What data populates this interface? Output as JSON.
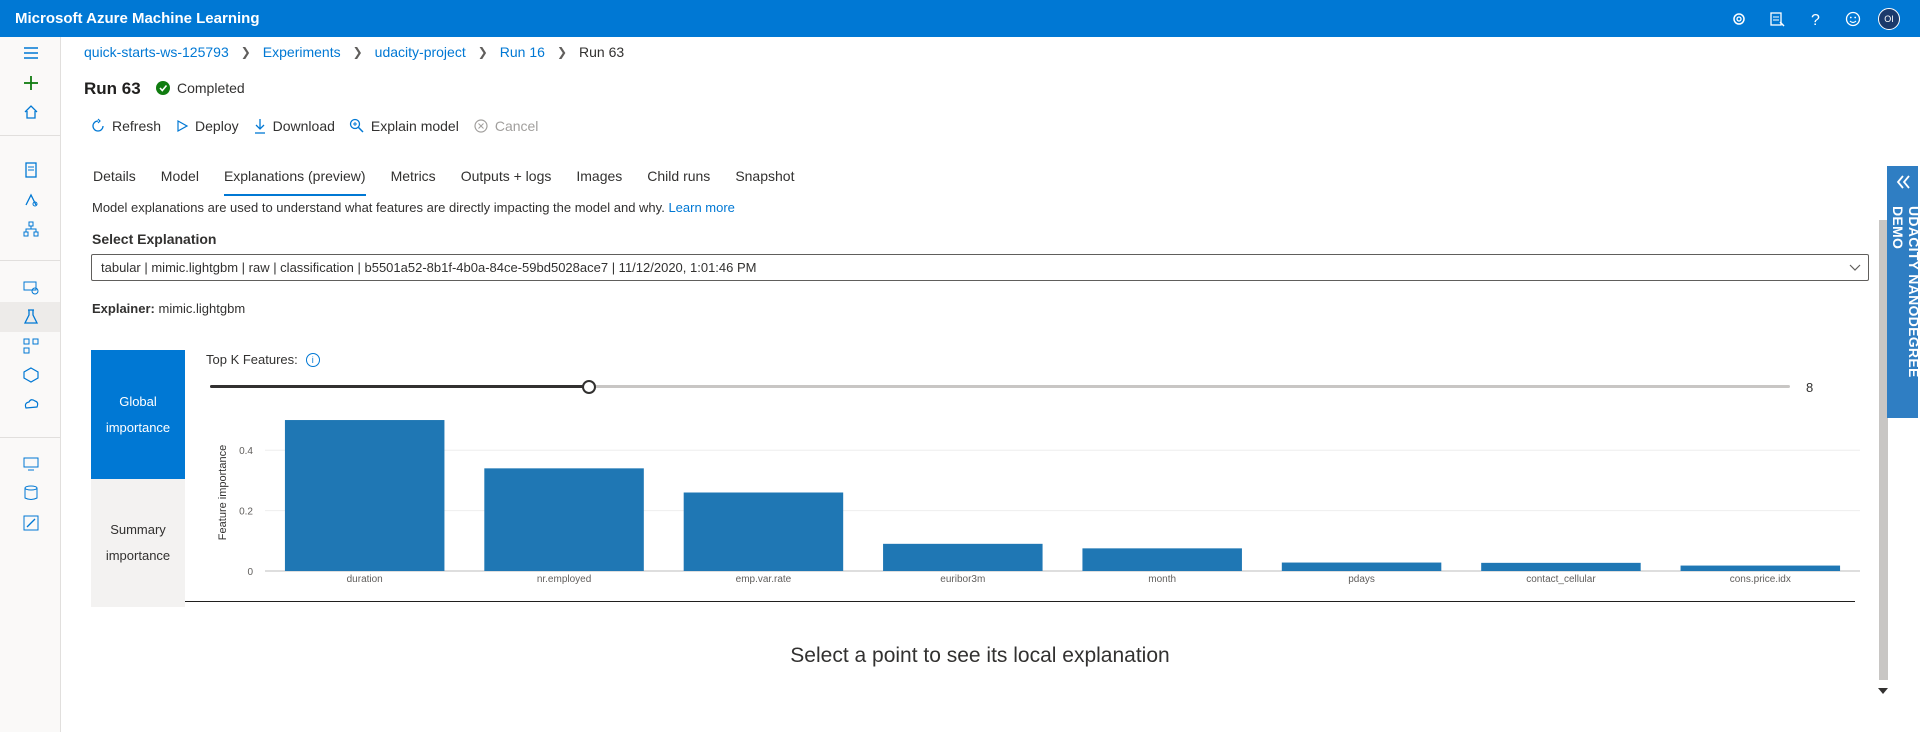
{
  "app": {
    "title": "Microsoft Azure Machine Learning",
    "avatar_initials": "OI"
  },
  "topbar_icons": [
    "gear-icon",
    "feedback-icon",
    "help-icon",
    "smiley-icon"
  ],
  "leftnav": [
    "hamburger-icon",
    "plus-icon",
    "home-icon",
    "notebook-icon",
    "automl-icon",
    "designer-icon",
    "datasets-icon",
    "experiments-icon",
    "pipelines-icon",
    "models-icon",
    "endpoints-icon",
    "compute-icon",
    "datastores-icon",
    "labeling-icon"
  ],
  "breadcrumb": [
    "quick-starts-ws-125793",
    "Experiments",
    "udacity-project",
    "Run 16",
    "Run 63"
  ],
  "run": {
    "title": "Run 63",
    "status": "Completed"
  },
  "commands": {
    "refresh": "Refresh",
    "deploy": "Deploy",
    "download": "Download",
    "explain": "Explain model",
    "cancel": "Cancel"
  },
  "tabs": [
    "Details",
    "Model",
    "Explanations (preview)",
    "Metrics",
    "Outputs + logs",
    "Images",
    "Child runs",
    "Snapshot"
  ],
  "active_tab": "Explanations (preview)",
  "description": {
    "text": "Model explanations are used to understand what features are directly impacting the model and why.",
    "link": "Learn more"
  },
  "select": {
    "label": "Select Explanation",
    "value": "tabular | mimic.lightgbm | raw | classification | b5501a52-8b1f-4b0a-84ce-59bd5028ace7 | 11/12/2020, 1:01:46 PM"
  },
  "explainer": {
    "label": "Explainer:",
    "value": "mimic.lightgbm"
  },
  "vtabs": {
    "global": [
      "Global",
      "importance"
    ],
    "summary": [
      "Summary",
      "importance"
    ]
  },
  "topk": {
    "label": "Top K Features:",
    "value": "8",
    "fraction": 0.24
  },
  "chart_data": {
    "type": "bar",
    "ylabel": "Feature importance",
    "categories": [
      "duration",
      "nr.employed",
      "emp.var.rate",
      "euribor3m",
      "month",
      "pdays",
      "contact_cellular",
      "cons.price.idx"
    ],
    "values": [
      0.5,
      0.34,
      0.26,
      0.09,
      0.075,
      0.028,
      0.027,
      0.018
    ],
    "yticks": [
      "0",
      "0.2",
      "0.4"
    ],
    "ylim": [
      0,
      0.52
    ],
    "bar_color": "#1f77b4",
    "grid": true
  },
  "local_message": "Select a point to see its local explanation",
  "side_badge": "UDACITY NANODEGREE DEMO"
}
